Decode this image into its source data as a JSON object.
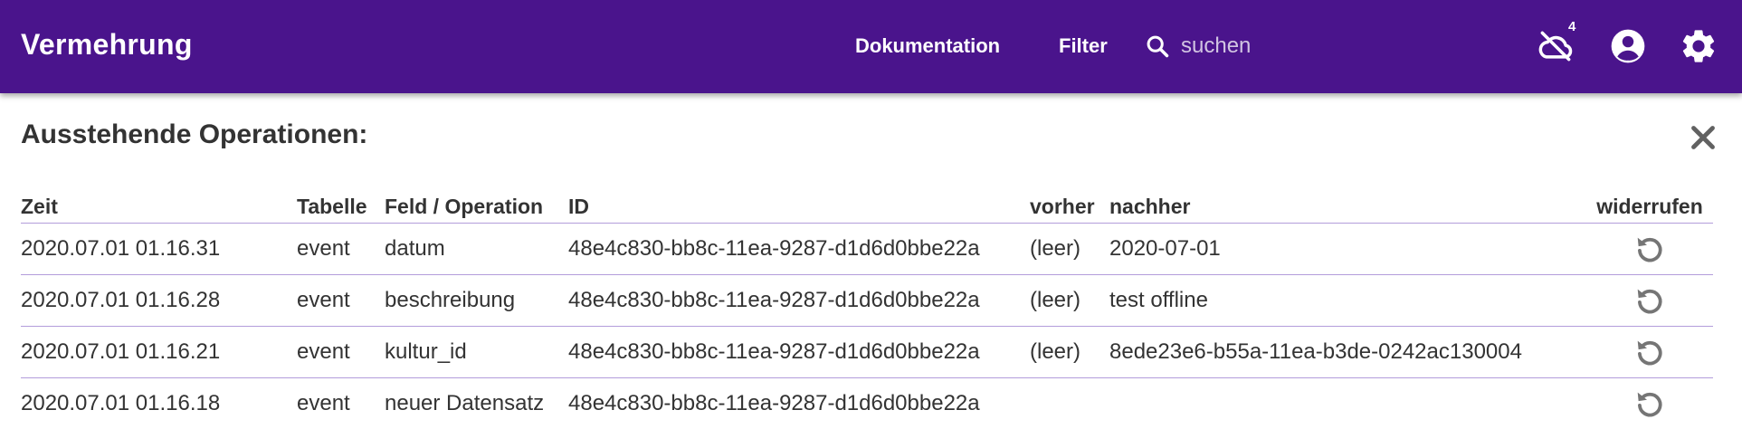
{
  "appbar": {
    "title": "Vermehrung",
    "nav": {
      "docs_label": "Dokumentation",
      "filter_label": "Filter"
    },
    "search": {
      "placeholder": "suchen",
      "value": ""
    },
    "offline_badge": "4",
    "icons": [
      "search-icon",
      "cloud-off-icon",
      "account-circle-icon",
      "gear-icon"
    ],
    "background_color": "#4a148c"
  },
  "panel": {
    "title": "Ausstehende Operationen:",
    "close_icon": "close-icon",
    "columns": [
      "Zeit",
      "Tabelle",
      "Feld / Operation",
      "ID",
      "vorher",
      "nachher",
      "widerrufen"
    ],
    "rows": [
      {
        "zeit": "2020.07.01 01.16.31",
        "tabelle": "event",
        "feld": "datum",
        "id": "48e4c830-bb8c-11ea-9287-d1d6d0bbe22a",
        "vorher": "(leer)",
        "nachher": "2020-07-01"
      },
      {
        "zeit": "2020.07.01 01.16.28",
        "tabelle": "event",
        "feld": "beschreibung",
        "id": "48e4c830-bb8c-11ea-9287-d1d6d0bbe22a",
        "vorher": "(leer)",
        "nachher": "test offline"
      },
      {
        "zeit": "2020.07.01 01.16.21",
        "tabelle": "event",
        "feld": "kultur_id",
        "id": "48e4c830-bb8c-11ea-9287-d1d6d0bbe22a",
        "vorher": "(leer)",
        "nachher": "8ede23e6-b55a-11ea-b3de-0242ac130004"
      },
      {
        "zeit": "2020.07.01 01.16.18",
        "tabelle": "event",
        "feld": "neuer Datensatz",
        "id": "48e4c830-bb8c-11ea-9287-d1d6d0bbe22a",
        "vorher": "",
        "nachher": ""
      }
    ],
    "undo_icon": "undo-icon"
  }
}
